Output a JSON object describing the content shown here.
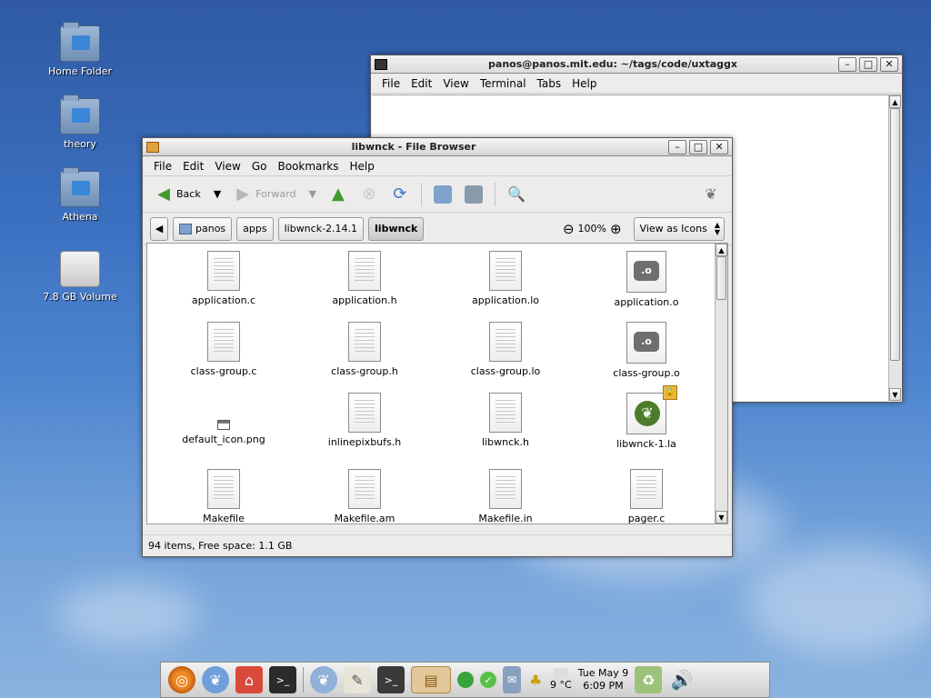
{
  "desktop": {
    "icons": [
      {
        "label": "Home Folder"
      },
      {
        "label": "theory"
      },
      {
        "label": "Athena"
      },
      {
        "label": "7.8 GB Volume"
      }
    ]
  },
  "terminal": {
    "title": "panos@panos.mit.edu: ~/tags/code/uxtaggx",
    "menu": [
      "File",
      "Edit",
      "View",
      "Terminal",
      "Tabs",
      "Help"
    ]
  },
  "browser": {
    "title": "libwnck - File Browser",
    "menu": [
      "File",
      "Edit",
      "View",
      "Go",
      "Bookmarks",
      "Help"
    ],
    "toolbar": {
      "back": "Back",
      "forward": "Forward"
    },
    "path": [
      "panos",
      "apps",
      "libwnck-2.14.1",
      "libwnck"
    ],
    "zoom": "100%",
    "view_mode": "View as Icons",
    "files": [
      {
        "name": "application.c",
        "type": "text"
      },
      {
        "name": "application.h",
        "type": "text"
      },
      {
        "name": "application.lo",
        "type": "text"
      },
      {
        "name": "application.o",
        "type": "object"
      },
      {
        "name": "class-group.c",
        "type": "text"
      },
      {
        "name": "class-group.h",
        "type": "text"
      },
      {
        "name": "class-group.lo",
        "type": "text"
      },
      {
        "name": "class-group.o",
        "type": "object"
      },
      {
        "name": "default_icon.png",
        "type": "image"
      },
      {
        "name": "inlinepixbufs.h",
        "type": "text"
      },
      {
        "name": "libwnck.h",
        "type": "text"
      },
      {
        "name": "libwnck-1.la",
        "type": "library"
      },
      {
        "name": "Makefile",
        "type": "text"
      },
      {
        "name": "Makefile.am",
        "type": "text"
      },
      {
        "name": "Makefile.in",
        "type": "text"
      },
      {
        "name": "pager.c",
        "type": "text"
      }
    ],
    "status": "94 items, Free space: 1.1 GB"
  },
  "panel": {
    "weather": "9 °C",
    "date": "Tue May  9",
    "time": "6:09 PM"
  },
  "colors": {
    "desktop_top": "#2f5aa3",
    "desktop_bottom": "#8bb3e0",
    "accent_green": "#3f9b2a"
  }
}
